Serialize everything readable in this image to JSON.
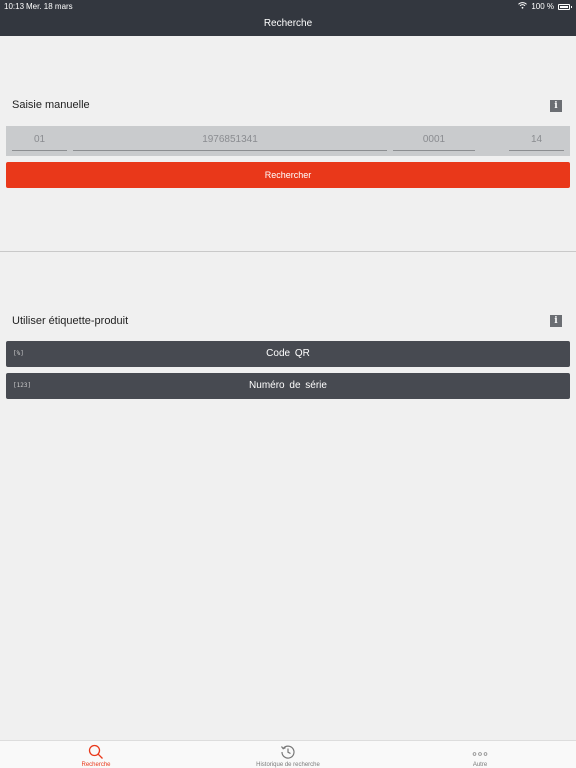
{
  "status_bar": {
    "time": "10:13",
    "date": "Mer. 18 mars",
    "battery": "100 %"
  },
  "nav": {
    "title": "Recherche"
  },
  "manual": {
    "title": "Saisie manuelle",
    "fields": [
      {
        "placeholder": "01"
      },
      {
        "placeholder": "1976851341"
      },
      {
        "placeholder": "0001"
      },
      {
        "placeholder": "14"
      }
    ],
    "search_label": "Rechercher"
  },
  "label_section": {
    "title": "Utiliser étiquette-produit",
    "qr_label": "Code QR",
    "qr_icon": "[%]",
    "serial_label": "Numéro de série",
    "serial_icon": "[123]"
  },
  "tabs": [
    {
      "label": "Recherche",
      "icon": "search-icon",
      "active": true
    },
    {
      "label": "Historique de recherche",
      "icon": "history-icon",
      "active": false
    },
    {
      "label": "Autre",
      "icon": "more-icon",
      "active": false
    }
  ],
  "colors": {
    "accent": "#e9381a",
    "topbar": "#33373f",
    "dark_button": "#474a51",
    "background": "#f0f0f0"
  }
}
